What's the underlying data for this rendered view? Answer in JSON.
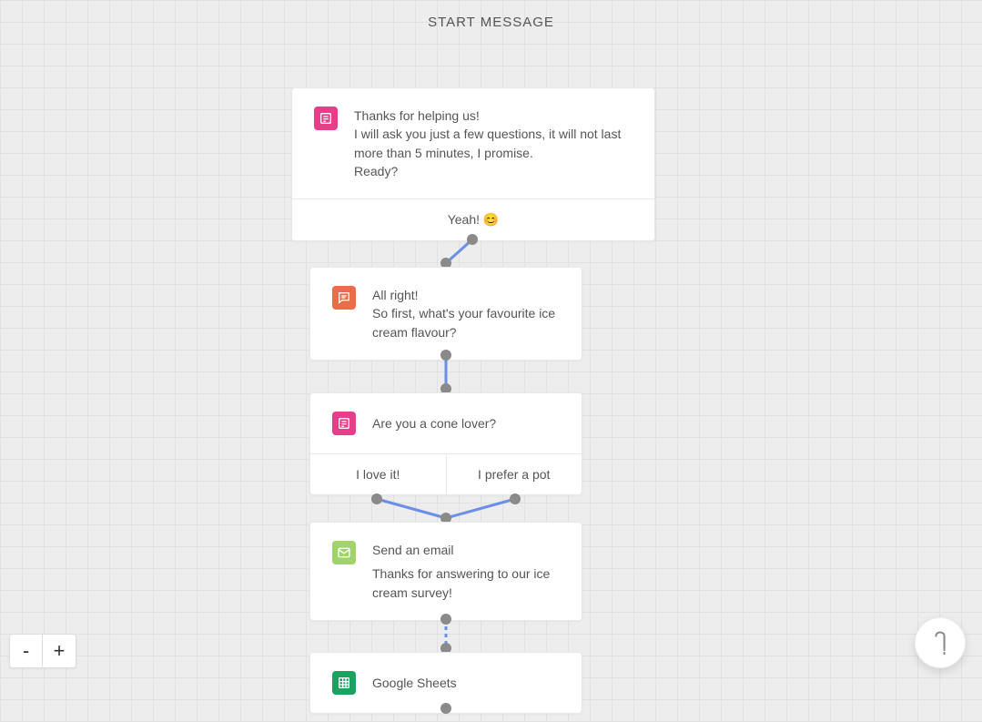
{
  "header": {
    "title": "START MESSAGE"
  },
  "nodes": {
    "n1": {
      "lines": [
        "Thanks for helping us!",
        "I will ask you just a few questions, it will not last more than 5 minutes, I promise.",
        "Ready?"
      ],
      "answer": "Yeah! 😊"
    },
    "n2": {
      "lines": [
        "All right!",
        "So first, what's your favourite ice cream flavour?"
      ]
    },
    "n3": {
      "question": "Are you a cone lover?",
      "option_a": "I love it!",
      "option_b": "I prefer a pot"
    },
    "n4": {
      "title": "Send an email",
      "body": "Thanks for answering to our ice cream survey!"
    },
    "n5": {
      "label": "Google Sheets"
    }
  },
  "zoom": {
    "out_label": "-",
    "in_label": "+"
  }
}
